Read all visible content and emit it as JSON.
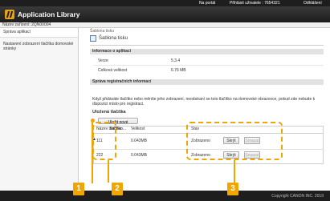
{
  "topbar": {
    "portal": "Na portál",
    "user": "Přihlásit uživatele : 7654321",
    "logout": "Odhlášení"
  },
  "app": {
    "title": "Application Library"
  },
  "device": {
    "label": "Název zařízení: 2QN00004"
  },
  "sidebar": {
    "items": [
      {
        "label": "Správa aplikací"
      },
      {
        "label": "Nastavení zobrazení tlačítka domovské stránky"
      }
    ]
  },
  "breadcrumb": "Šablona tisku",
  "page": {
    "title": "Šablona tisku"
  },
  "app_info": {
    "heading": "Informace o aplikaci",
    "version_label": "Verze",
    "version_value": "5.3.4",
    "size_label": "Celková velikost",
    "size_value": "6.76 MB"
  },
  "reg_info": {
    "heading": "Správa registračních informací",
    "description": "Když přidáváte tlačítko nebo měníte jeho zobrazení, neodstraní se toto tlačítko na domovské obrazovce, pokud zde nebude k dispozici místo pro registraci."
  },
  "saved": {
    "heading": "Uložená tlačítka",
    "register_button": "Uložit nové tlačítko...",
    "columns": {
      "name": "Název tlačítka",
      "size": "Velikost",
      "status": "Stav"
    },
    "rows": [
      {
        "name": "111",
        "size": "0.043MB",
        "status": "Zobrazeno",
        "hide": "Skrýt",
        "delete": "Smazat"
      },
      {
        "name": "222",
        "size": "0.043MB",
        "status": "Zobrazeno",
        "hide": "Skrýt",
        "delete": "Smazat"
      }
    ]
  },
  "sort_marker": "▲",
  "footer": {
    "copyright": "Copyright CANON INC. 2019"
  },
  "callouts": {
    "one": "1",
    "two": "2",
    "three": "3"
  },
  "colors": {
    "callout": "#f0a500",
    "header": "#1e1e1e",
    "logo": "#e8a317"
  }
}
